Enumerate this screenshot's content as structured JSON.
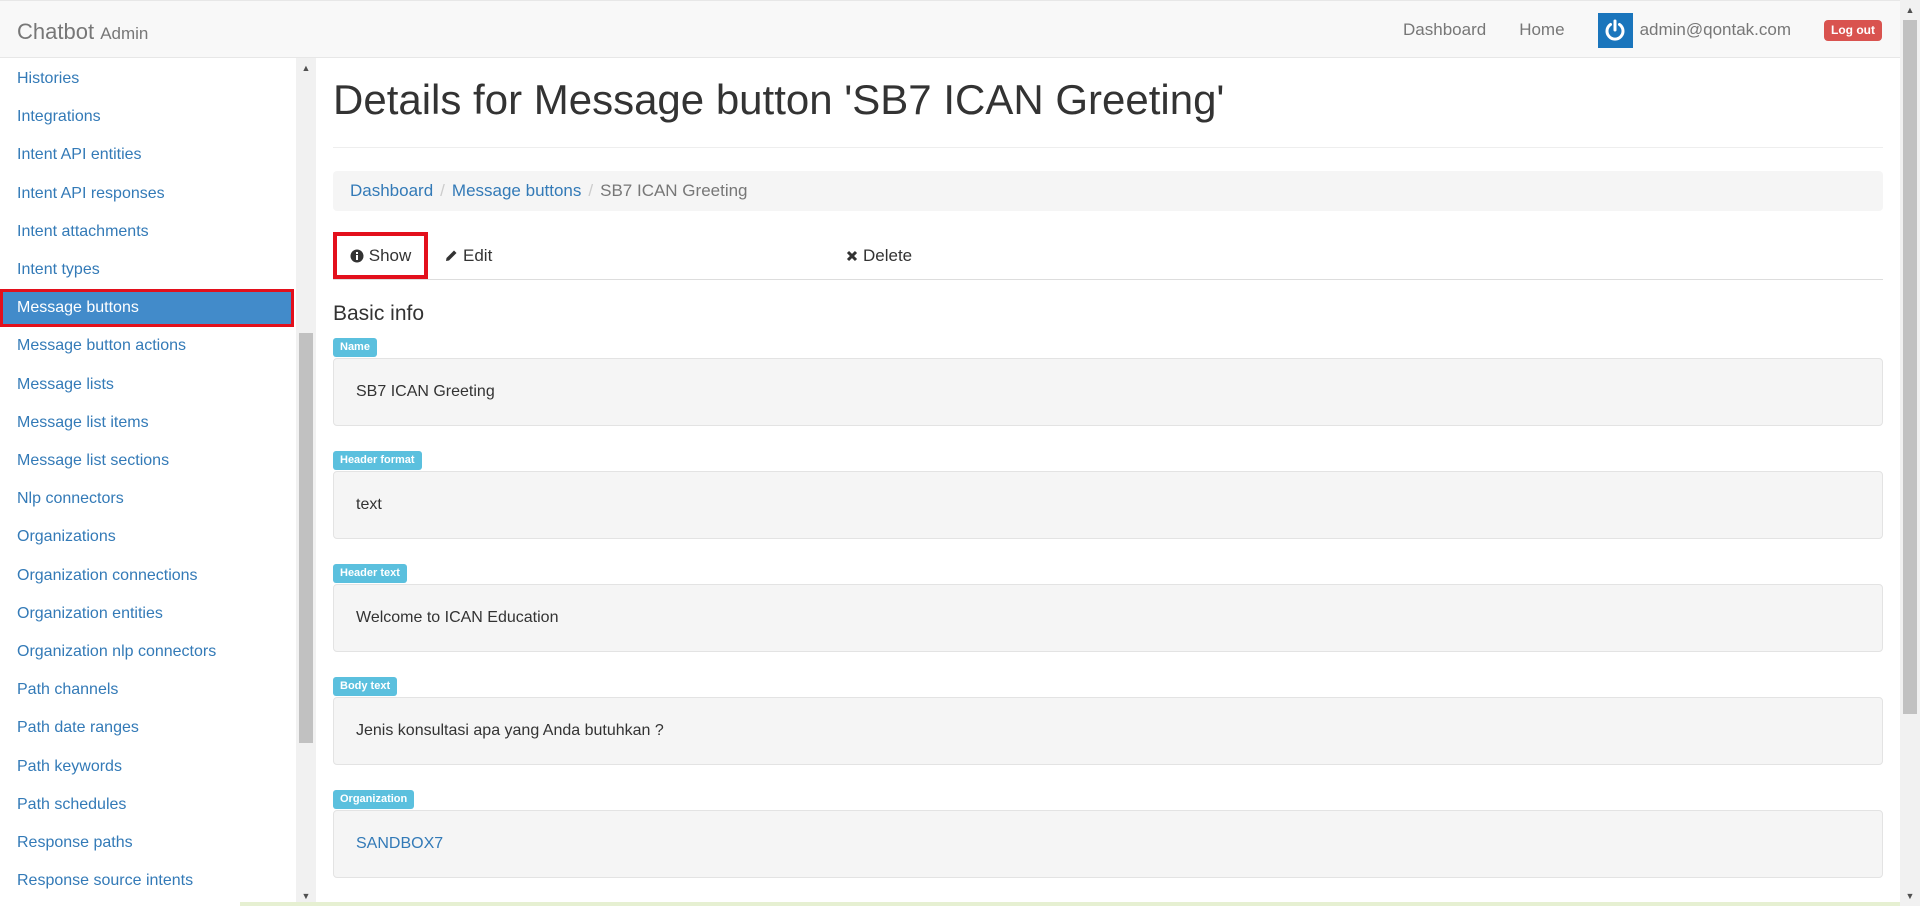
{
  "navbar": {
    "brand": "Chatbot",
    "brand_sub": "Admin",
    "links": [
      "Dashboard",
      "Home"
    ],
    "user_email": "admin@qontak.com",
    "logout_label": "Log out"
  },
  "sidebar": {
    "items": [
      {
        "label": "Histories",
        "active": false
      },
      {
        "label": "Integrations",
        "active": false
      },
      {
        "label": "Intent API entities",
        "active": false
      },
      {
        "label": "Intent API responses",
        "active": false
      },
      {
        "label": "Intent attachments",
        "active": false
      },
      {
        "label": "Intent types",
        "active": false
      },
      {
        "label": "Message buttons",
        "active": true
      },
      {
        "label": "Message button actions",
        "active": false
      },
      {
        "label": "Message lists",
        "active": false
      },
      {
        "label": "Message list items",
        "active": false
      },
      {
        "label": "Message list sections",
        "active": false
      },
      {
        "label": "Nlp connectors",
        "active": false
      },
      {
        "label": "Organizations",
        "active": false
      },
      {
        "label": "Organization connections",
        "active": false
      },
      {
        "label": "Organization entities",
        "active": false
      },
      {
        "label": "Organization nlp connectors",
        "active": false
      },
      {
        "label": "Path channels",
        "active": false
      },
      {
        "label": "Path date ranges",
        "active": false
      },
      {
        "label": "Path keywords",
        "active": false
      },
      {
        "label": "Path schedules",
        "active": false
      },
      {
        "label": "Response paths",
        "active": false
      },
      {
        "label": "Response source intents",
        "active": false
      }
    ]
  },
  "main": {
    "title": "Details for Message button 'SB7 ICAN Greeting'",
    "breadcrumb": {
      "items": [
        "Dashboard",
        "Message buttons"
      ],
      "current": "SB7 ICAN Greeting"
    },
    "tabs": {
      "show": "Show",
      "edit": "Edit",
      "delete": "Delete"
    },
    "section_title": "Basic info",
    "fields": [
      {
        "label": "Name",
        "value": "SB7 ICAN Greeting",
        "is_link": false
      },
      {
        "label": "Header format",
        "value": "text",
        "is_link": false
      },
      {
        "label": "Header text",
        "value": "Welcome to ICAN Education",
        "is_link": false
      },
      {
        "label": "Body text",
        "value": "Jenis konsultasi apa yang Anda butuhkan ?",
        "is_link": false
      },
      {
        "label": "Organization",
        "value": "SANDBOX7",
        "is_link": true
      }
    ]
  },
  "colors": {
    "active_nav": "#428bca",
    "highlight_border": "#e3101c",
    "label_info": "#5bc0de",
    "link": "#337ab7",
    "logout": "#d9534f",
    "avatar": "#1a75bc"
  },
  "icons": {
    "avatar": "power-icon",
    "show": "info-circle-icon",
    "edit": "pencil-icon",
    "delete": "times-icon"
  }
}
